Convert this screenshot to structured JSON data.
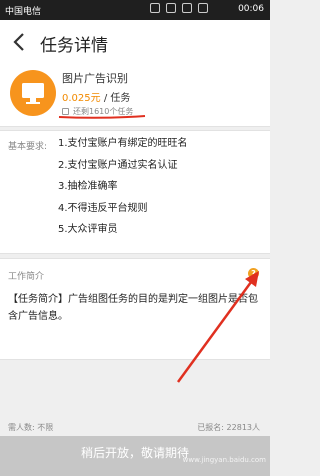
{
  "status_bar": {
    "carrier": "中国电信",
    "time": "00:06"
  },
  "header": {
    "title": "任务详情"
  },
  "task": {
    "name": "图片广告识别",
    "price_amount": "0.025元",
    "price_unit": " / 任务",
    "completed": "还剩1610个任务",
    "icon": "monitor-icon",
    "accent_color": "#f7941d"
  },
  "requirements": {
    "label": "基本要求:",
    "items": [
      "1.支付宝账户有绑定的旺旺名",
      "2.支付宝账户通过实名认证",
      "3.抽检准确率",
      "4.不得违反平台规则",
      "5.大众评审员"
    ]
  },
  "intro": {
    "label": "工作简介",
    "text": "【任务简介】广告组图任务的目的是判定一组图片是否包含广告信息。",
    "help_icon": "question-icon"
  },
  "stats": {
    "limit": "需人数: 不限",
    "signed": "已报名: 22813人"
  },
  "footer": {
    "button_label": "稍后开放，敬请期待",
    "watermark": "www.jingyan.baidu.com"
  }
}
